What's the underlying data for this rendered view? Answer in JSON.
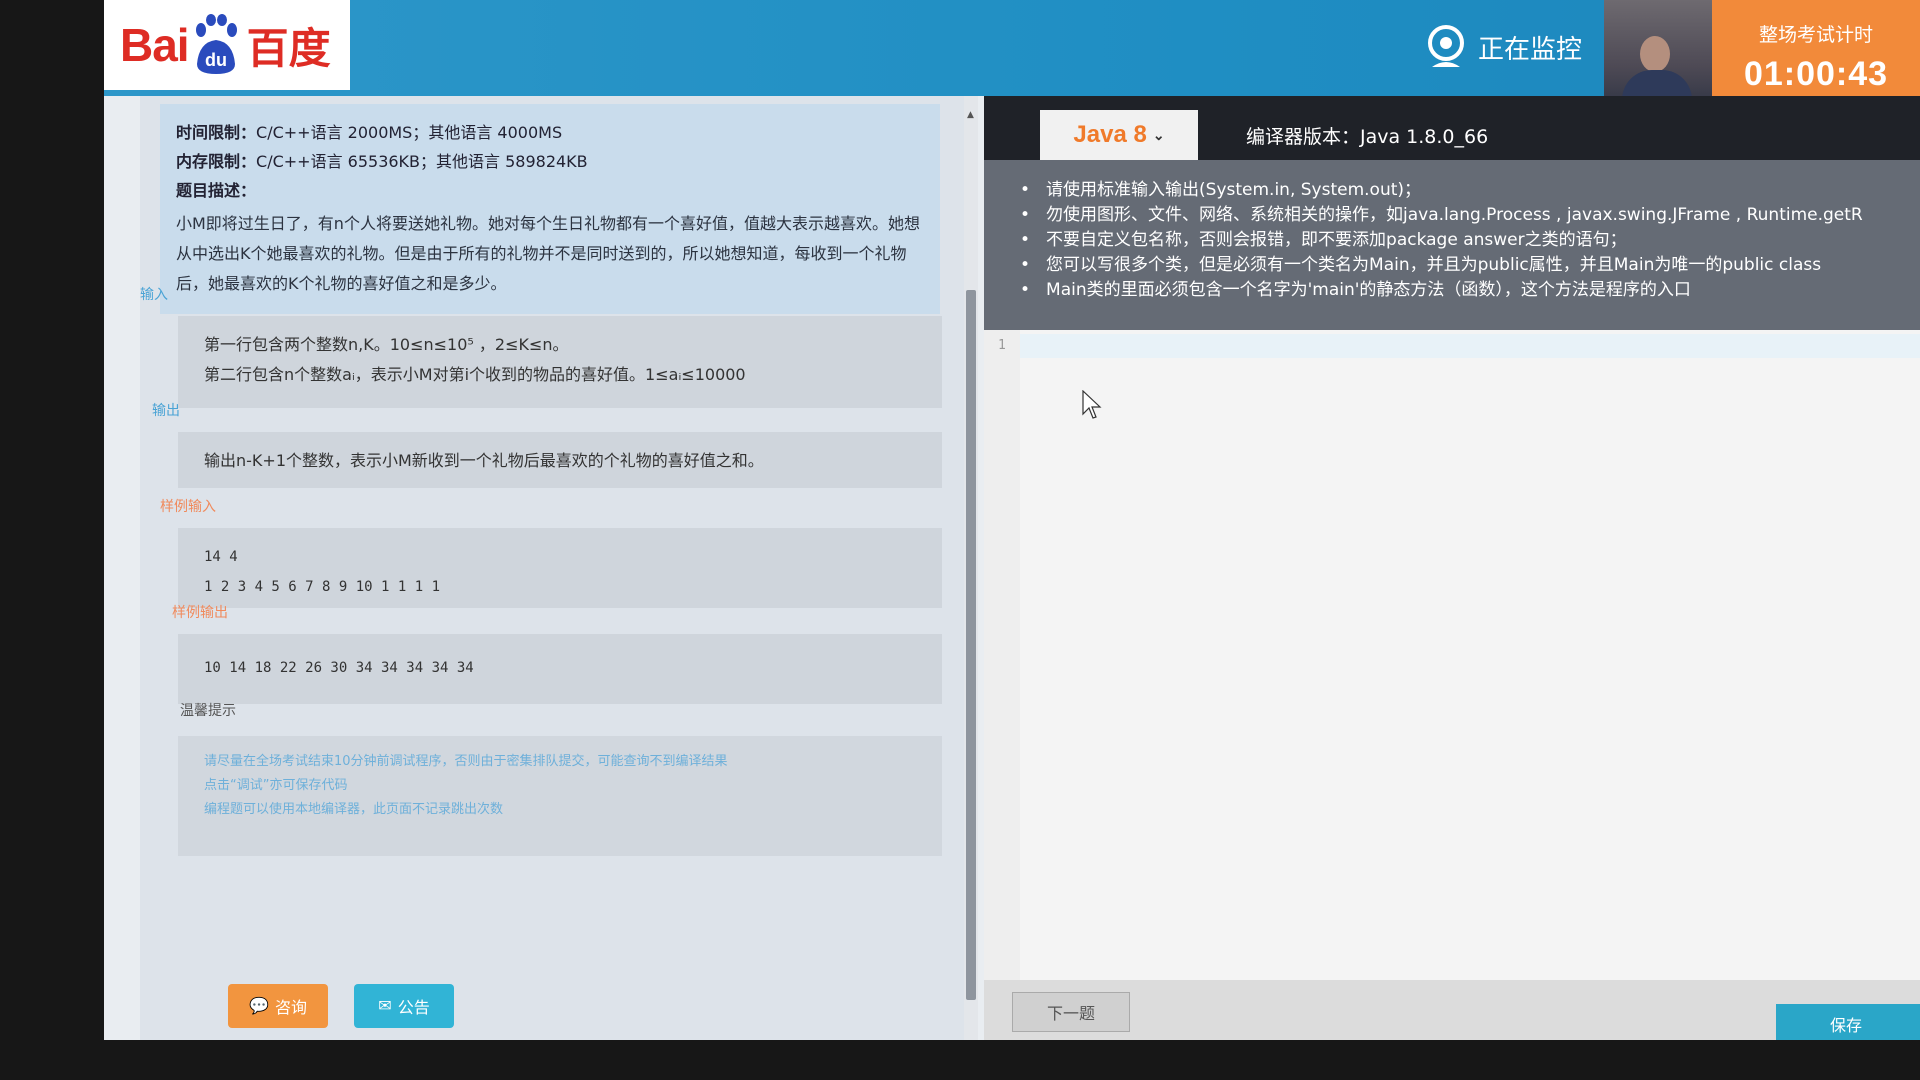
{
  "header": {
    "logo_text_left": "Bai",
    "logo_paw_text": "du",
    "logo_text_right": "百度",
    "monitor_label": "正在监控",
    "timer_label": "整场考试计时",
    "timer_value": "01:00:43"
  },
  "problem": {
    "time_limit_label": "时间限制：",
    "time_limit": "C/C++语言 2000MS；其他语言 4000MS",
    "memory_limit_label": "内存限制：",
    "memory_limit": "C/C++语言 65536KB；其他语言 589824KB",
    "description_label": "题目描述：",
    "description": "小M即将过生日了，有n个人将要送她礼物。她对每个生日礼物都有一个喜好值，值越大表示越喜欢。她想从中选出K个她最喜欢的礼物。但是由于所有的礼物并不是同时送到的，所以她想知道，每收到一个礼物后，她最喜欢的K个礼物的喜好值之和是多少。",
    "input_label": "输入",
    "input_line1": "第一行包含两个整数n,K。10≤n≤10⁵ ，2≤K≤n。",
    "input_line2": "第二行包含n个整数aᵢ，表示小M对第i个收到的物品的喜好值。1≤aᵢ≤10000",
    "output_label": "输出",
    "output_text": "输出n-K+1个整数，表示小M新收到一个礼物后最喜欢的个礼物的喜好值之和。",
    "sample_input_label": "样例输入",
    "sample_input_line1": "14 4",
    "sample_input_line2": "1 2 3 4 5 6 7 8 9 10 1 1 1 1",
    "sample_output_label": "样例输出",
    "sample_output": "10 14 18 22 26 30 34 34 34 34 34",
    "tips_label": "温馨提示",
    "tip1": "请尽量在全场考试结束10分钟前调试程序，否则由于密集排队提交，可能查询不到编译结果",
    "tip2": "点击“调试”亦可保存代码",
    "tip3": "编程题可以使用本地编译器，此页面不记录跳出次数"
  },
  "buttons": {
    "consult": "咨询",
    "notice": "公告",
    "next": "下一题",
    "save": "保存"
  },
  "editor": {
    "language": "Java 8",
    "compiler_version": "编译器版本：Java 1.8.0_66",
    "notes": [
      "请使用标准输入输出(System.in, System.out)；",
      "勿使用图形、文件、网络、系统相关的操作，如java.lang.Process , javax.swing.JFrame , Runtime.getR",
      "不要自定义包名称，否则会报错，即不要添加package answer之类的语句；",
      "您可以写很多个类，但是必须有一个类名为Main，并且为public属性，并且Main为唯一的public class",
      "Main类的里面必须包含一个名字为'main'的静态方法（函数），这个方法是程序的入口"
    ],
    "line_number": "1"
  },
  "colors": {
    "header_blue": "#2d97c9",
    "timer_orange": "#f28a3a",
    "accent_orange": "#f07a2a",
    "consult_orange": "#f2953f",
    "notice_teal": "#31b4d6"
  }
}
